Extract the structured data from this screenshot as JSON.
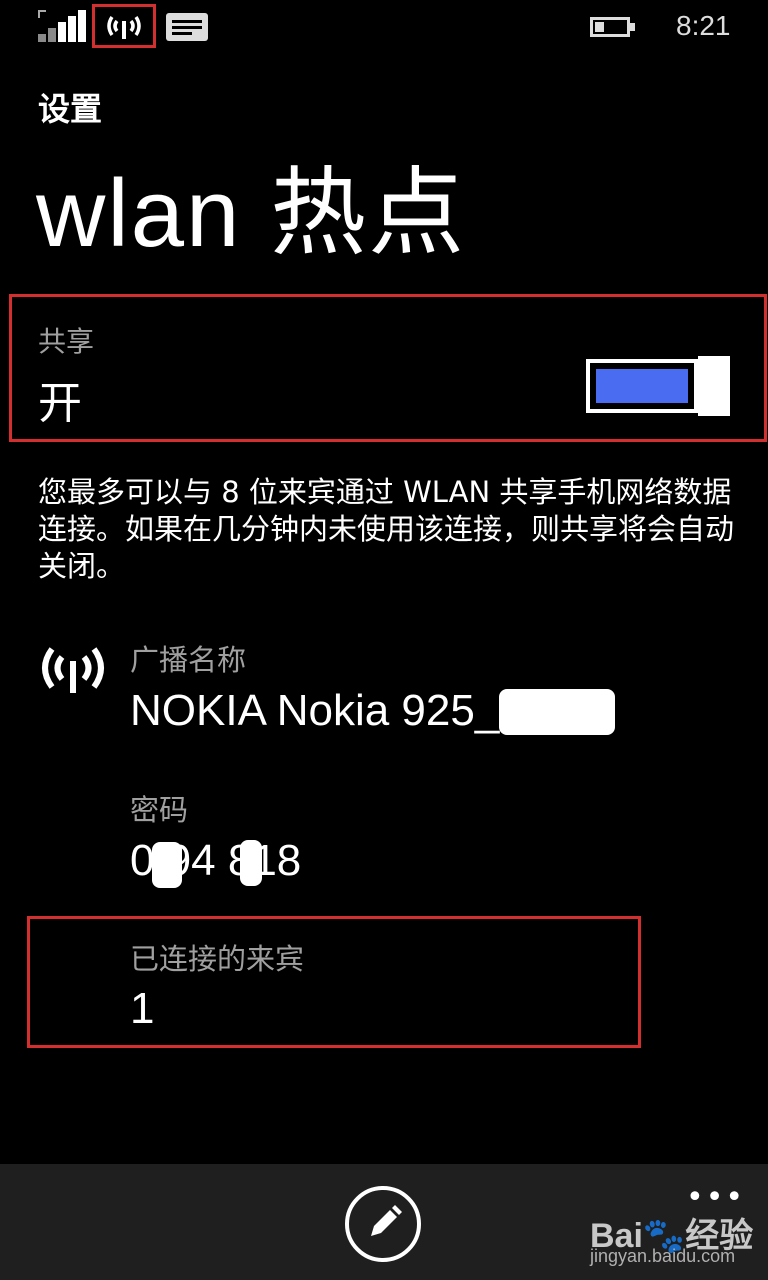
{
  "status_bar": {
    "time": "8:21",
    "signal_icon": "signal-strength-icon",
    "hotspot_icon": "hotspot-broadcast-icon",
    "message_icon": "message-icon",
    "battery_level": 0.3
  },
  "header": {
    "app_title": "设置",
    "page_title": "wlan 热点"
  },
  "sharing": {
    "label": "共享",
    "value": "开",
    "toggle_on": true,
    "toggle_color": "#4a6cf0"
  },
  "description": "您最多可以与 8 位来宾通过 WLAN 共享手机网络数据连接。如果在几分钟内未使用该连接，则共享将会自动关闭。",
  "broadcast": {
    "label": "广播名称",
    "value": "NOKIA Nokia 925_"
  },
  "password": {
    "label": "密码",
    "value": "0  94 818"
  },
  "guests": {
    "label": "已连接的来宾",
    "value": "1"
  },
  "app_bar": {
    "edit_icon": "pencil-icon",
    "more_label": "•••"
  },
  "watermark": {
    "logo": "Bai🐾经验",
    "url": "jingyan.baidu.com"
  },
  "colors": {
    "highlight": "#d32f2f",
    "accent": "#4a6cf0"
  }
}
